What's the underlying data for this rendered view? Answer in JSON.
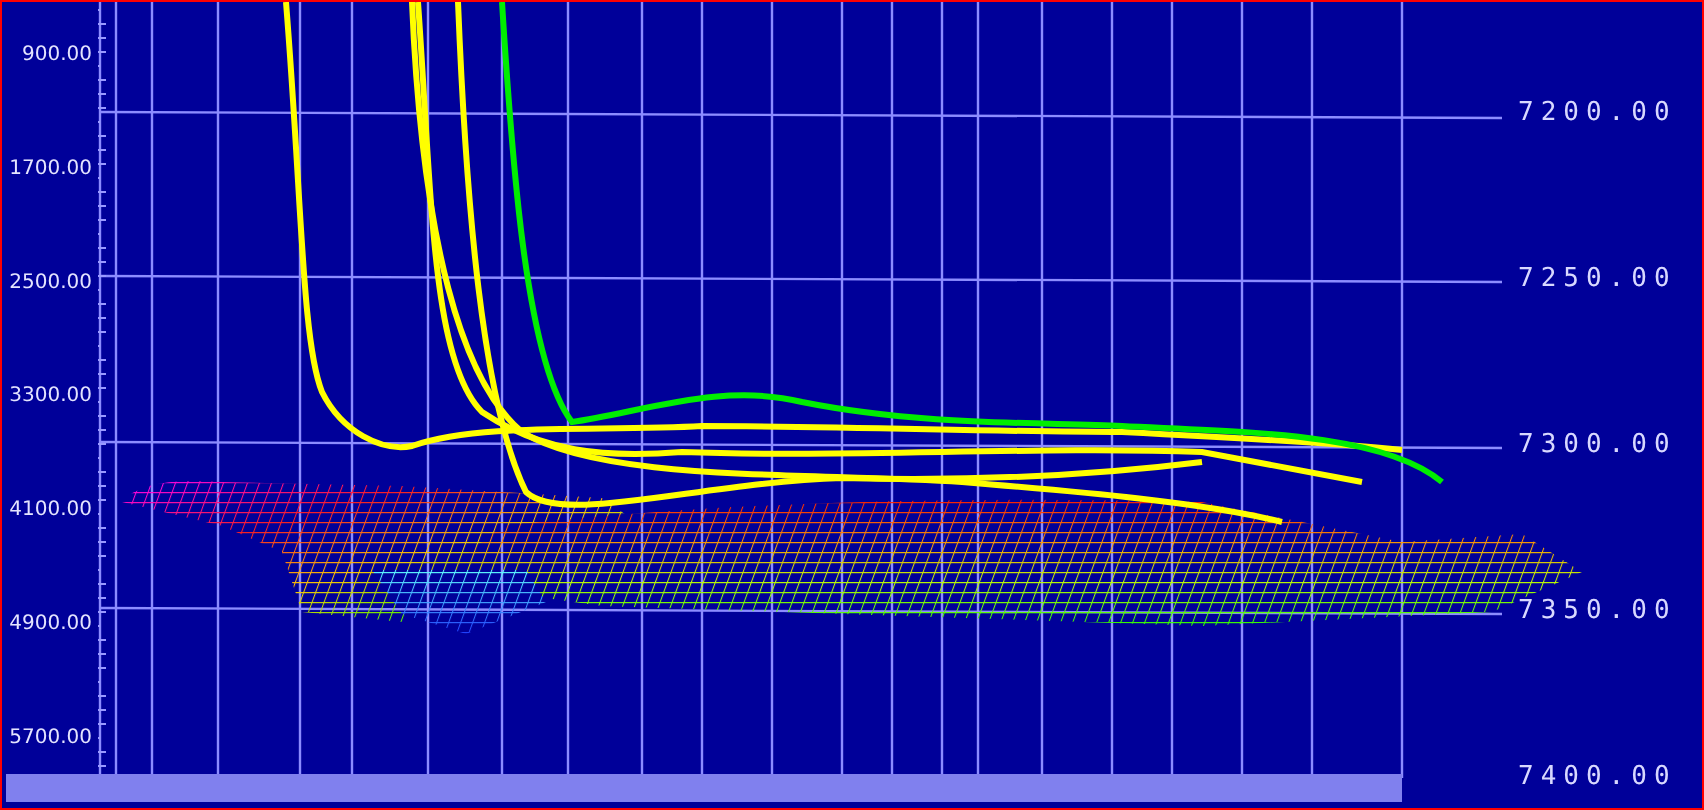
{
  "left_axis": {
    "labels": [
      "900.00",
      "1700.00",
      "2500.00",
      "3300.00",
      "4100.00",
      "4900.00",
      "5700.00"
    ]
  },
  "right_axis": {
    "labels": [
      "7200.00",
      "7250.00",
      "7300.00",
      "7350.00",
      "7400.00"
    ]
  }
}
